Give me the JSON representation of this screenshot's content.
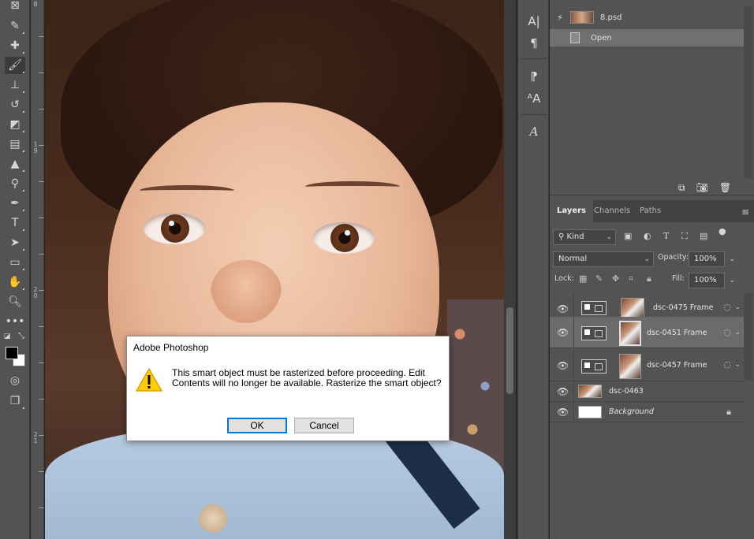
{
  "ruler": {
    "labels": [
      "8",
      "1\n9",
      "2\n0",
      "2\n1"
    ]
  },
  "history": {
    "doc_name": "8.psd",
    "items": [
      {
        "label": "Open"
      }
    ]
  },
  "layers_panel": {
    "tabs": [
      "Layers",
      "Channels",
      "Paths"
    ],
    "filter_kind": "Kind",
    "blend_mode": "Normal",
    "opacity_label": "Opacity:",
    "opacity_value": "100%",
    "lock_label": "Lock:",
    "fill_label": "Fill:",
    "fill_value": "100%",
    "layers": [
      {
        "name": "dsc-0475 Frame",
        "type": "frame",
        "visible": true
      },
      {
        "name": "dsc-0451 Frame",
        "type": "frame",
        "visible": true,
        "selected": true
      },
      {
        "name": "dsc-0457 Frame",
        "type": "frame",
        "visible": true
      },
      {
        "name": "dsc-0463",
        "type": "image",
        "visible": true
      },
      {
        "name": "Background",
        "type": "background",
        "visible": true,
        "locked": true
      }
    ]
  },
  "dialog": {
    "title": "Adobe Photoshop",
    "message": "This smart object must be rasterized before proceeding.  Edit Contents will no longer be available.  Rasterize the smart object?",
    "ok_label": "OK",
    "cancel_label": "Cancel"
  },
  "colors": {
    "foreground": "#000000",
    "background": "#ffffff",
    "accent": "#0078d7",
    "warning": "#ffcc00"
  }
}
